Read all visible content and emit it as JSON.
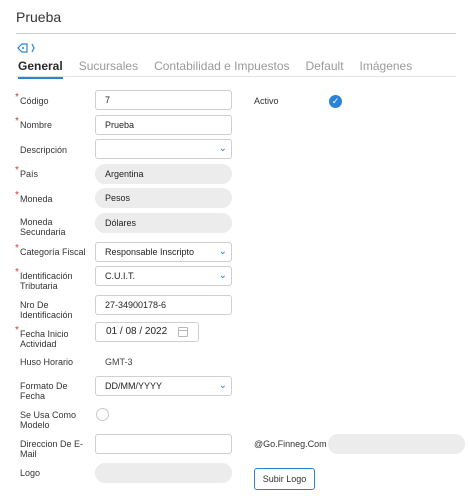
{
  "header": {
    "title": "Prueba",
    "tag_icon": "tag-icon"
  },
  "tabs": [
    {
      "label": "General",
      "active": true
    },
    {
      "label": "Sucursales",
      "active": false
    },
    {
      "label": "Contabilidad e Impuestos",
      "active": false
    },
    {
      "label": "Default",
      "active": false
    },
    {
      "label": "Imágenes",
      "active": false
    }
  ],
  "form": {
    "codigo": {
      "label": "Código",
      "value": "7",
      "required": true
    },
    "nombre": {
      "label": "Nombre",
      "value": "Prueba",
      "required": true
    },
    "descripcion": {
      "label": "Descripción",
      "value": ""
    },
    "pais": {
      "label": "País",
      "value": "Argentina",
      "required": true
    },
    "moneda": {
      "label": "Moneda",
      "value": "Pesos",
      "required": true
    },
    "moneda_secundaria": {
      "label": "Moneda Secundaria",
      "value": "Dólares"
    },
    "categoria_fiscal": {
      "label": "Categoría Fiscal",
      "value": "Responsable Inscripto",
      "required": true
    },
    "identificacion_tributaria": {
      "label": "Identificación Tributaria",
      "value": "C.U.I.T.",
      "required": true
    },
    "nro_identificacion": {
      "label": "Nro De Identificación",
      "value": "27-34900178-6"
    },
    "fecha_inicio": {
      "label": "Fecha Inicio Actividad",
      "value": "01 / 08 / 2022",
      "required": true
    },
    "huso_horario": {
      "label": "Huso Horario",
      "value": "GMT-3"
    },
    "formato_fecha": {
      "label": "Formato De Fecha",
      "value": "DD/MM/YYYY"
    },
    "usa_modelo": {
      "label": "Se Usa Como Modelo",
      "checked": false
    },
    "email": {
      "label": "Direccion De E-Mail",
      "value": "",
      "domain": "@Go.Finneg.Com"
    },
    "logo": {
      "label": "Logo",
      "button": "Subir Logo"
    },
    "activo": {
      "label": "Activo",
      "checked": true
    }
  },
  "colors": {
    "accent": "#2b82d9",
    "required": "#d23b3b",
    "readonly_bg": "#ececec"
  },
  "icons": {
    "chevron": "chevron-down-icon",
    "check": "check-circle-icon",
    "calendar": "calendar-icon"
  }
}
